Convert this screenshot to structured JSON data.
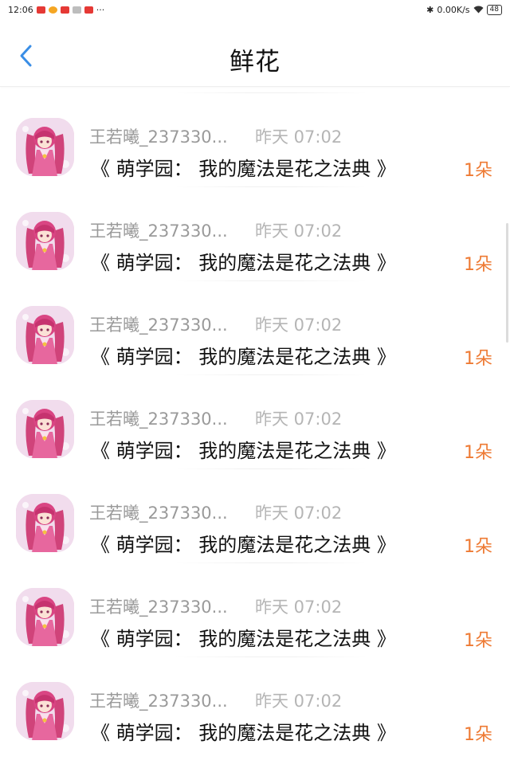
{
  "status_bar": {
    "time": "12:06",
    "notification_icon_colors": [
      "#e53935",
      "#f5a623",
      "#e53935",
      "#bdbdbd",
      "#e53935"
    ],
    "more": "···",
    "network_speed": "0.00K/s",
    "battery": "48"
  },
  "header": {
    "title": "鲜花",
    "back_icon": "chevron-left-icon",
    "accent_color": "#3a8ee6"
  },
  "records": [
    {
      "user": "王若曦_237330...",
      "time": "昨天 07:02",
      "book": "《 萌学园： 我的魔法是花之法典 》",
      "count": "1朵"
    },
    {
      "user": "王若曦_237330...",
      "time": "昨天 07:02",
      "book": "《 萌学园： 我的魔法是花之法典 》",
      "count": "1朵"
    },
    {
      "user": "王若曦_237330...",
      "time": "昨天 07:02",
      "book": "《 萌学园： 我的魔法是花之法典 》",
      "count": "1朵"
    },
    {
      "user": "王若曦_237330...",
      "time": "昨天 07:02",
      "book": "《 萌学园： 我的魔法是花之法典 》",
      "count": "1朵"
    },
    {
      "user": "王若曦_237330...",
      "time": "昨天 07:02",
      "book": "《 萌学园： 我的魔法是花之法典 》",
      "count": "1朵"
    },
    {
      "user": "王若曦_237330...",
      "time": "昨天 07:02",
      "book": "《 萌学园： 我的魔法是花之法典 》",
      "count": "1朵"
    },
    {
      "user": "王若曦_237330...",
      "time": "昨天 07:02",
      "book": "《 萌学园： 我的魔法是花之法典 》",
      "count": "1朵"
    }
  ],
  "colors": {
    "count_text": "#ee7a33",
    "name_text": "#9a9a9a",
    "time_text": "#b5b5b5"
  }
}
